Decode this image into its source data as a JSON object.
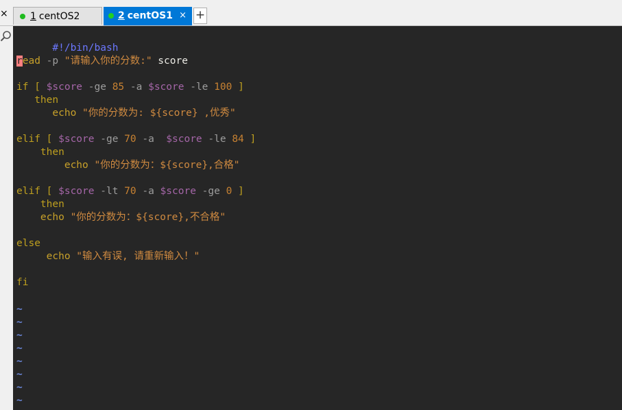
{
  "tabs": [
    {
      "number": "1",
      "title": "centOS2",
      "active": false
    },
    {
      "number": "2",
      "title": "centOS1",
      "active": true,
      "close": "×"
    }
  ],
  "add_tab_label": "+",
  "close_all_label": "×",
  "icons": {
    "search": "search-icon",
    "status_dot": "status-dot-icon"
  },
  "colors": {
    "tab_active": "#0078d7",
    "terminal_bg": "#262626",
    "status_dot": "#22d122",
    "cursor": "#ff8080"
  },
  "script": {
    "shebang": "#!/bin/bash",
    "read": {
      "cursor_char": "r",
      "cmd_rest": "ead",
      "opt": " -p ",
      "prompt": "\"请输入你的分数:\"",
      "arg": " score"
    },
    "if1": {
      "kw": "if [ ",
      "v1": "$score",
      "op1": " -ge ",
      "n1": "85",
      "op2": " -a ",
      "v2": "$score",
      "op3": " -le ",
      "n2": "100",
      "close": " ]"
    },
    "then1": "   then",
    "echo1": {
      "indent": "      ",
      "cmd": "echo",
      "str": " \"你的分数为: ${score} ,优秀\""
    },
    "elif1": {
      "kw": "elif [ ",
      "v1": "$score",
      "op1": " -ge ",
      "n1": "70",
      "op2": " -a  ",
      "v2": "$score",
      "op3": " -le ",
      "n2": "84",
      "close": " ]"
    },
    "then2": "    then",
    "echo2": {
      "indent": "        ",
      "cmd": "echo",
      "str": " \"你的分数为：${score},合格\""
    },
    "elif2": {
      "kw": "elif [ ",
      "v1": "$score",
      "op1": " -lt ",
      "n1": "70",
      "op2": " -a ",
      "v2": "$score",
      "op3": " -ge ",
      "n2": "0",
      "close": " ]"
    },
    "then3": "    then",
    "echo3": {
      "indent": "    ",
      "cmd": "echo",
      "str": " \"你的分数为：${score},不合格\""
    },
    "else": "else",
    "echo4": {
      "indent": "     ",
      "cmd": "echo",
      "str": " \"输入有误, 请重新输入！\""
    },
    "fi": "fi",
    "tilde": "~"
  }
}
